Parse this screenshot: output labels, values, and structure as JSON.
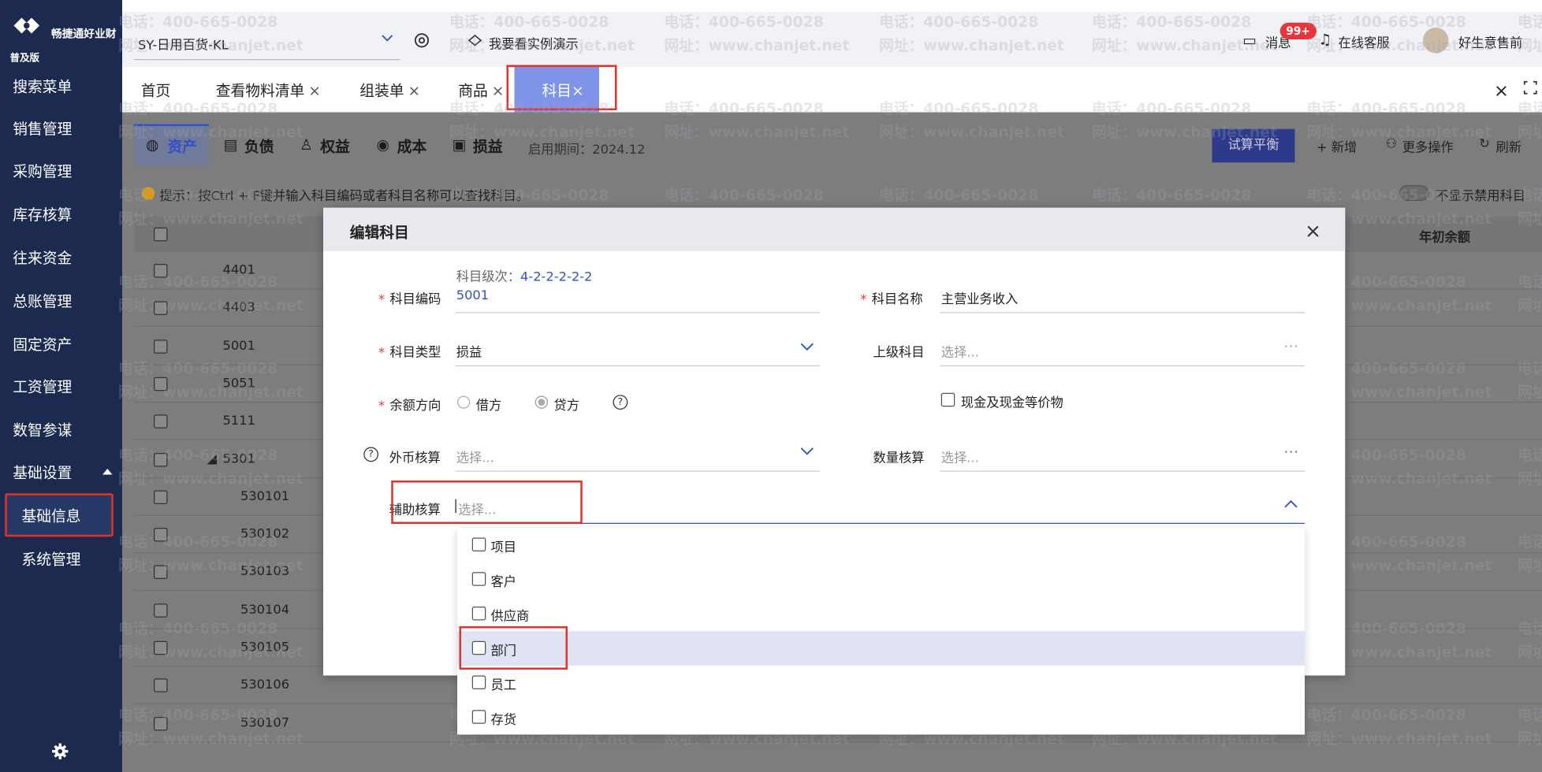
{
  "app": {
    "brand": "畅捷通好业财",
    "edition": "普及版"
  },
  "sidebar": {
    "items": [
      {
        "label": "搜索菜单"
      },
      {
        "label": "销售管理"
      },
      {
        "label": "采购管理"
      },
      {
        "label": "库存核算"
      },
      {
        "label": "往来资金"
      },
      {
        "label": "总账管理"
      },
      {
        "label": "固定资产"
      },
      {
        "label": "工资管理"
      },
      {
        "label": "数智参谋"
      },
      {
        "label": "基础设置"
      }
    ],
    "sub_items": [
      {
        "label": "基础信息"
      },
      {
        "label": "系统管理"
      }
    ],
    "settings_icon": "gear-icon"
  },
  "header": {
    "company": "SY-日用百货-KL",
    "demo": "我要看实例演示",
    "messages": "消息",
    "badge": "99+",
    "service": "在线客服",
    "user": "好生意售前"
  },
  "tabs": {
    "items": [
      {
        "label": "首页"
      },
      {
        "label": "查看物料清单"
      },
      {
        "label": "组装单"
      },
      {
        "label": "商品"
      }
    ],
    "close": "×",
    "active": "科目"
  },
  "page": {
    "categories": [
      "资产",
      "负债",
      "权益",
      "成本",
      "损益"
    ],
    "period": "启用期间：2024.12",
    "trial_balance": "试算平衡",
    "add": "+ 新增",
    "more": "更多操作",
    "refresh": "刷新",
    "tip": "提示：按Ctrl + F键并输入科目编码或者科目名称可以查找科目。",
    "hide_disabled": "不显示禁用科目",
    "col_year_balance": "年初余额",
    "rows": [
      "4401",
      "4403",
      "5001",
      "5051",
      "5111",
      "5301",
      "530101",
      "530102",
      "530103",
      "530104",
      "530105",
      "530106",
      "530107"
    ]
  },
  "modal": {
    "title": "编辑科目",
    "close": "×",
    "level_label": "科目级次：",
    "level_value": "4-2-2-2-2-2",
    "code_label": "科目编码",
    "code_value": "5001",
    "name_label": "科目名称",
    "name_value": "主营业务收入",
    "type_label": "科目类型",
    "type_value": "损益",
    "parent_label": "上级科目",
    "parent_placeholder": "选择...",
    "direction_label": "余额方向",
    "debit": "借方",
    "credit": "贷方",
    "cash_equiv": "现金及现金等价物",
    "currency_label": "外币核算",
    "currency_placeholder": "选择...",
    "quantity_label": "数量核算",
    "quantity_placeholder": "选择...",
    "aux_label": "辅助核算",
    "aux_placeholder": "选择...",
    "aux_options": [
      "项目",
      "客户",
      "供应商",
      "部门",
      "员工",
      "存货"
    ]
  },
  "watermark": {
    "phone": "电话：400-665-0028",
    "site": "网址：www.chanjet.net"
  },
  "colors": {
    "sidebar": "#1b2a4e",
    "accent": "#3350c8",
    "tab_active": "#7f94e8",
    "highlight": "#e0332a"
  }
}
